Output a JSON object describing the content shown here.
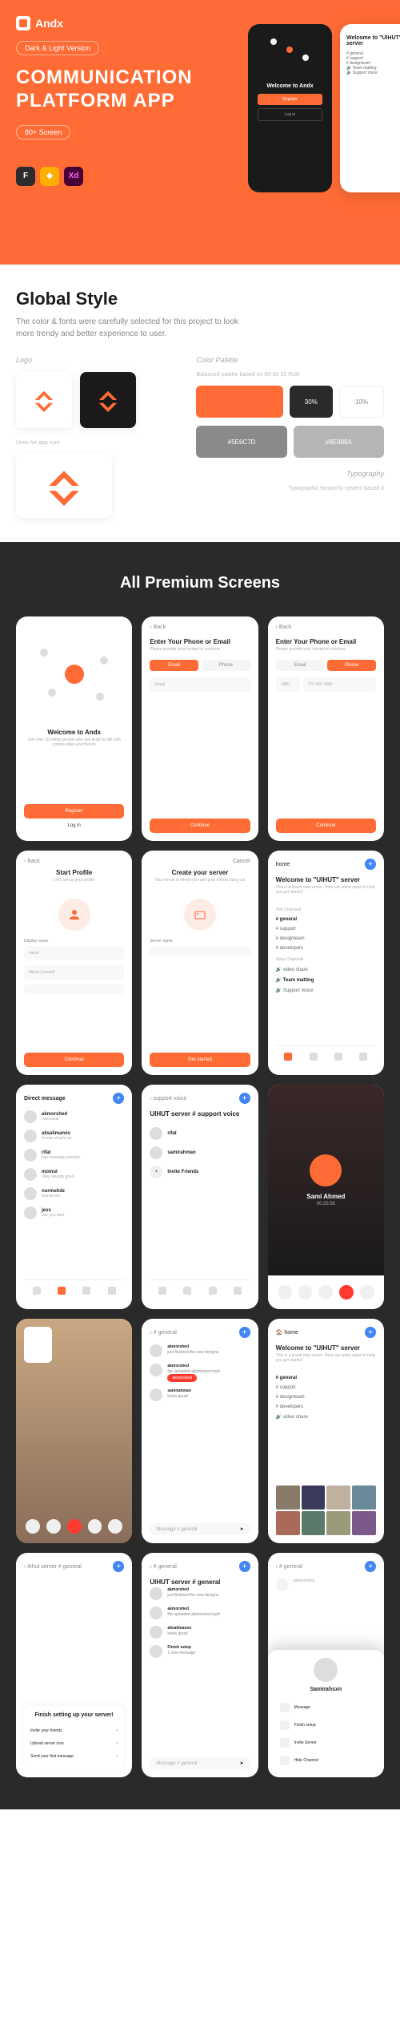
{
  "hero": {
    "brand": "Andx",
    "version_badge": "Dark & Light Version",
    "title_line1": "COMMUNICATION",
    "title_line2": "PLATFORM APP",
    "screen_badge": "80+ Screen",
    "phone_welcome": "Welcome to Andx",
    "phone_server_title": "Welcome to \"UIHUT\" server",
    "register": "Register",
    "login": "Log in"
  },
  "tools": {
    "figma": "F",
    "sketch": "◆",
    "xd": "Xd"
  },
  "style": {
    "title": "Global Style",
    "desc": "The color & fonts were carefully selected for this project to look more trendy and better experience to user.",
    "logo_label": "Logo",
    "logo_sub": "Uses for app icon",
    "palette_label": "Color Palette",
    "palette_sub": "Balanced palette based on 60-30-10 Rule",
    "typo_label": "Typography",
    "typo_sub": "Typographic hierarchy system based o",
    "hex1": "#5E6C7D",
    "hex2": "#8E989A",
    "pct1": "30%",
    "pct2": "10%"
  },
  "premium": {
    "title": "All Premium Screens"
  },
  "screens": {
    "back": "‹ Back",
    "cancel": "Cancel",
    "welcome_title": "Welcome to Andx",
    "welcome_sub": "Join over 10 million people who use Andx to talk with communities and friends",
    "enter_phone": "Enter Your Phone or Email",
    "enter_phone_sub": "Please provide your contact to continue",
    "email": "Email",
    "phone": "Phone",
    "code": "+880",
    "number": "170 456 7890",
    "continue": "Continue",
    "start_profile": "Start Profile",
    "start_profile_sub": "Let's set up your profile",
    "display_name": "Display name",
    "name_hint": "name",
    "about_hint": "About yourself",
    "create_server": "Create your server",
    "create_server_sub": "Your server is where you and your friends hang out",
    "server_name": "Server name",
    "get_started": "Get started",
    "server_welcome": "Welcome to \"UIHUT\" server",
    "server_welcome_sub": "This is a brand new server. Here are some steps to help you get started",
    "text_channels": "Text Channels",
    "ch_general": "# general",
    "ch_support": "# support",
    "ch_designteam": "# designteam",
    "ch_developers": "# developers",
    "voice_channels": "Voice Channels",
    "vc_video": "🔊 video share",
    "vc_team": "🔊 Team matting",
    "vc_support": "🔊 Support Voice",
    "dm_header": "Direct message",
    "dm1_name": "akmorshed",
    "dm1_msg": "nomoskar",
    "dm2_name": "alisalimanov",
    "dm2_msg": "hi man what's up",
    "dm3_name": "rifat",
    "dm3_msg": "last message preview",
    "dm4_name": "moinul",
    "dm4_msg": "okay sounds good",
    "dm5_name": "nurmuhdz",
    "dm5_msg": "thanks bro",
    "dm6_name": "jess",
    "dm6_msg": "see you later",
    "support_voice": "support voice",
    "server_channel": "UIHUT server # support voice",
    "user_rifat": "rifat",
    "user_sami": "samirahman",
    "invite": "Invite Friends",
    "calling_name": "Sami Ahmed",
    "calling_time": "00:25:56",
    "general_channel": "# general",
    "server_general": "UIHUT server # general",
    "msg1_name": "akmorshed",
    "msg1_text": "just finished the new designs",
    "msg2_name": "akmorshed",
    "msg2_text": "file uploaded akmorshed.mp4",
    "msg3_name": "samirahman",
    "msg3_text": "looks great!",
    "msg_placeholder": "Message # general",
    "finish_setup": "Finish setting up your server!",
    "invite_friends": "Invite your friends",
    "upload_icon": "Upload server icon",
    "first_message": "Send your first message",
    "popup_name": "Samirahsxn",
    "popup_msg": "Message",
    "popup_setup": "Finish setup",
    "invite_server": "Invite Server",
    "hide_channel": "Hide Channel",
    "home": "home"
  }
}
